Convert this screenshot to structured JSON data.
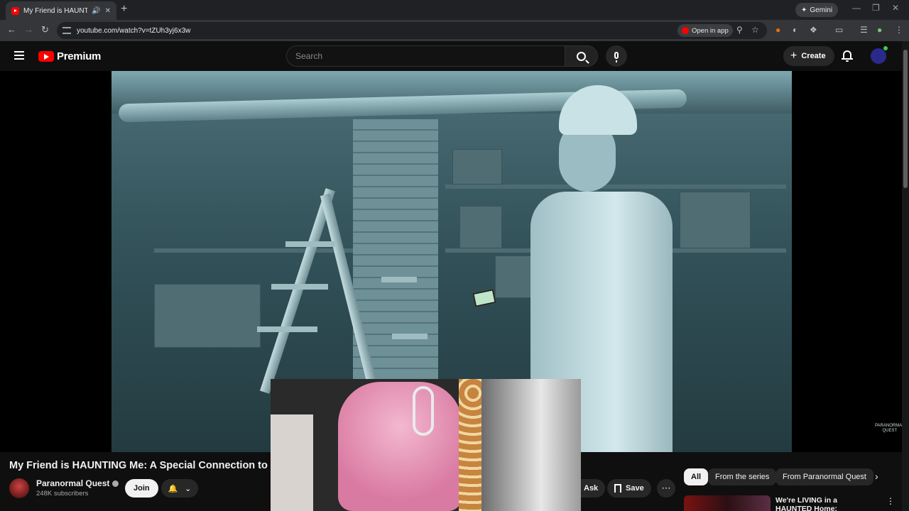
{
  "browser": {
    "tab_title": "My Friend is HAUNTING Me",
    "new_tab_label": "+",
    "gemini_label": "Gemini",
    "url": "youtube.com/watch?v=tZUh3yj6x3w",
    "open_in_app_label": "Open in app"
  },
  "header": {
    "logo_text": "Premium",
    "search_placeholder": "Search",
    "create_label": "Create"
  },
  "player": {
    "watermark_line1": "PARANORMAL",
    "watermark_line2": "QUEST"
  },
  "video": {
    "title": "My Friend is HAUNTING Me: A Special Connection to a G",
    "channel_name": "Paranormal Quest",
    "subscribers": "248K subscribers",
    "join_label": "Join",
    "ask_label": "Ask",
    "save_label": "Save"
  },
  "sidebar": {
    "chips": [
      {
        "label": "All"
      },
      {
        "label": "From the series"
      },
      {
        "label": "From Paranormal Quest"
      }
    ],
    "recommendations": [
      {
        "title": "We're LIVING in a HAUNTED Home: Paranormal Activity"
      }
    ]
  },
  "colors": {
    "youtube_red": "#ff0000",
    "background": "#0f0f0f",
    "chip_active": "#f1f1f1"
  }
}
